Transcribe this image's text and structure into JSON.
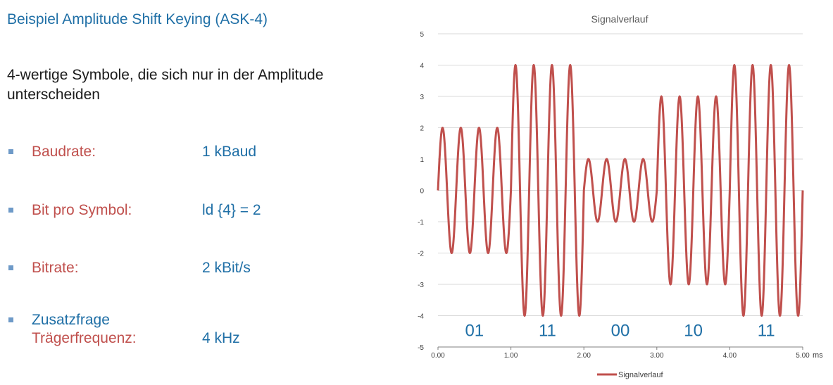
{
  "slide": {
    "title": "Beispiel Amplitude Shift Keying (ASK-4)",
    "subtitle": "4-wertige Symbole, die sich nur in der Amplitude unterscheiden"
  },
  "bullets": [
    {
      "label": "Baudrate:",
      "value": "1 kBaud"
    },
    {
      "label": "Bit pro Symbol:",
      "value": "ld {4} = 2"
    },
    {
      "label": "Bitrate:",
      "value": "2 kBit/s"
    },
    {
      "prefix": "Zusatzfrage",
      "label": "Trägerfrequenz:",
      "value": "4 kHz"
    }
  ],
  "colors": {
    "title": "#1f6fa6",
    "label": "#c0504d",
    "value": "#1f6fa6",
    "bullet": "#6e9ac8",
    "series": "#c0504d",
    "grid": "#d9d9d9"
  },
  "chart_data": {
    "type": "line",
    "title": "Signalverlauf",
    "x_unit": "ms",
    "xlim": [
      0,
      5
    ],
    "ylim": [
      -5,
      5
    ],
    "x_ticks": [
      "0.00",
      "1.00",
      "2.00",
      "3.00",
      "4.00",
      "5.00"
    ],
    "y_ticks": [
      "5",
      "4",
      "3",
      "2",
      "1",
      "0",
      "-1",
      "-2",
      "-3",
      "-4",
      "-5"
    ],
    "grid": true,
    "legend_position": "bottom",
    "series": [
      {
        "name": "Signalverlauf",
        "carrier_frequency_khz": 4,
        "symbol_duration_ms": 1,
        "amplitudes": [
          2,
          4,
          1,
          3,
          4
        ]
      }
    ],
    "symbol_labels": [
      "01",
      "11",
      "00",
      "10",
      "11"
    ]
  }
}
